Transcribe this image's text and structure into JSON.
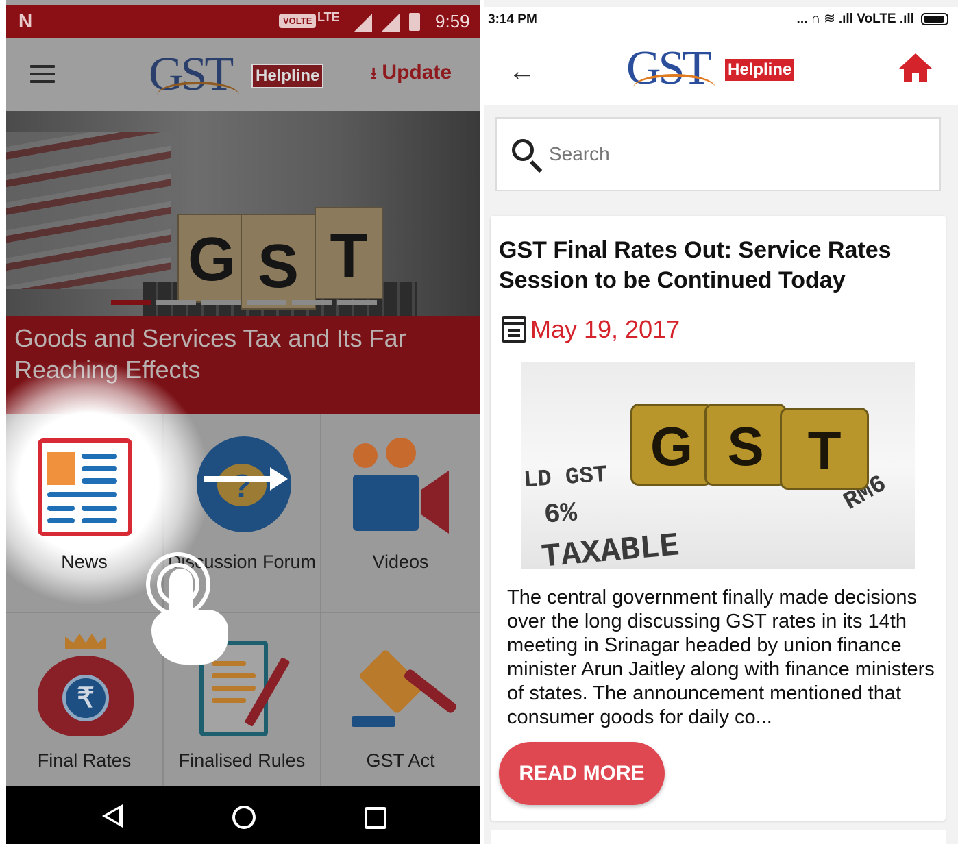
{
  "left_phone": {
    "status_bar": {
      "time": "9:59",
      "volte": "VOLTE",
      "network": "LTE"
    },
    "app_bar": {
      "logo_text": "GST",
      "logo_badge": "Helpline",
      "update_label": "Update"
    },
    "banner": {
      "caption": "Goods and Services Tax and Its Far Reaching Effects",
      "cube_letters": [
        "G",
        "S",
        "T"
      ],
      "slides": 6,
      "active_slide": 1
    },
    "tiles": [
      {
        "label": "News",
        "icon": "newspaper-icon"
      },
      {
        "label": "Discussion Forum",
        "icon": "forum-question-icon"
      },
      {
        "label": "Videos",
        "icon": "video-camera-icon"
      },
      {
        "label": "Final Rates",
        "icon": "money-bag-rupee-icon"
      },
      {
        "label": "Finalised Rules",
        "icon": "document-pen-icon"
      },
      {
        "label": "GST Act",
        "icon": "gavel-icon"
      }
    ],
    "gesture": {
      "type": "swipe-right-hint",
      "icons": [
        "tap-hand-icon",
        "arrow-right-icon"
      ]
    },
    "nav_bar": {
      "icons": [
        "back-triangle-icon",
        "home-circle-icon",
        "recents-square-icon"
      ]
    }
  },
  "right_phone": {
    "status_bar": {
      "time": "3:14 PM",
      "icons_text": "... ∩ ≋ .ıll VoLTE .ıll"
    },
    "app_bar": {
      "logo_text": "GST",
      "logo_badge": "Helpline",
      "back_glyph": "←"
    },
    "search": {
      "placeholder": "Search"
    },
    "article": {
      "title": "GST Final Rates Out: Service Rates Session to be Continued Today",
      "date": "May 19, 2017",
      "image_text": {
        "cubes": [
          "G",
          "S",
          "T"
        ],
        "line1": "LD GST",
        "line2": "6%",
        "line3": "TAXABLE",
        "side": "RM6"
      },
      "excerpt": "The central government finally made decisions over the long discussing GST rates in its 14th meeting in Srinagar headed by union finance minister Arun Jaitley along with finance ministers of states. The announcement mentioned that consumer goods for daily co...",
      "read_more": "READ MORE"
    }
  },
  "colors": {
    "brand_red": "#d4232b",
    "brand_blue": "#2a4e9b",
    "accent_orange": "#e07a1e",
    "button_red": "#e04851"
  }
}
